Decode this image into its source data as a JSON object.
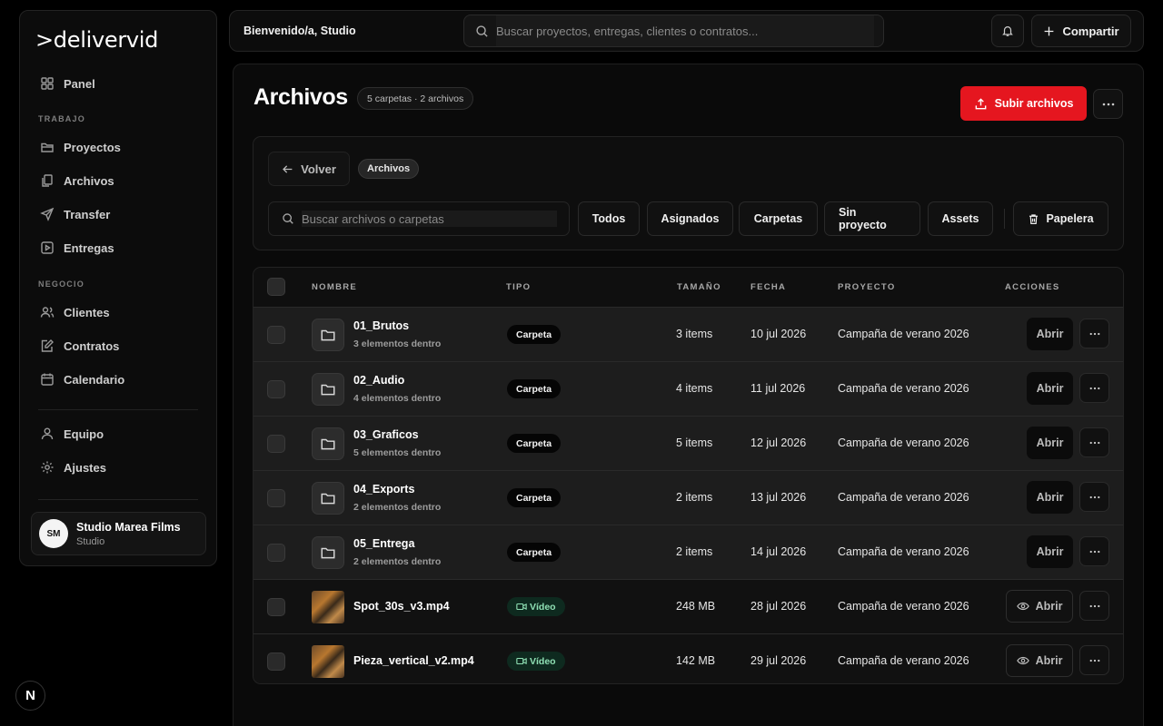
{
  "app": {
    "logo": ">delivervid",
    "next_badge": "N"
  },
  "sidebar": {
    "panel": "Panel",
    "section_work": "TRABAJO",
    "projects": "Proyectos",
    "files": "Archivos",
    "transfer": "Transfer",
    "deliveries": "Entregas",
    "section_business": "NEGOCIO",
    "clients": "Clientes",
    "contracts": "Contratos",
    "calendar": "Calendario",
    "team": "Equipo",
    "settings": "Ajustes",
    "user": {
      "initials": "SM",
      "name": "Studio Marea Films",
      "role": "Studio"
    }
  },
  "topbar": {
    "welcome": "Bienvenido/a, Studio",
    "search_placeholder": "Buscar proyectos, entregas, clientes o contratos...",
    "share_label": "Compartir"
  },
  "page": {
    "title": "Archivos",
    "count": "5 carpetas · 2 archivos",
    "upload_label": "Subir archivos"
  },
  "toolbar": {
    "back_label": "Volver",
    "breadcrumb": "Archivos",
    "search_placeholder": "Buscar archivos o carpetas",
    "filters": {
      "all": "Todos",
      "assigned": "Asignados",
      "folders": "Carpetas",
      "no_project": "Sin proyecto",
      "assets": "Assets"
    },
    "trash_label": "Papelera"
  },
  "table": {
    "headers": {
      "name": "NOMBRE",
      "type": "TIPO",
      "size": "TAMAÑO",
      "date": "FECHA",
      "project": "PROYECTO",
      "actions": "ACCIONES"
    },
    "rows": [
      {
        "name": "01_Brutos",
        "sub": "3 elementos dentro",
        "type": "Carpeta",
        "size": "3 items",
        "date": "10 jul 2026",
        "project": "Campaña de verano 2026",
        "action": "Abrir"
      },
      {
        "name": "02_Audio",
        "sub": "4 elementos dentro",
        "type": "Carpeta",
        "size": "4 items",
        "date": "11 jul 2026",
        "project": "Campaña de verano 2026",
        "action": "Abrir"
      },
      {
        "name": "03_Graficos",
        "sub": "5 elementos dentro",
        "type": "Carpeta",
        "size": "5 items",
        "date": "12 jul 2026",
        "project": "Campaña de verano 2026",
        "action": "Abrir"
      },
      {
        "name": "04_Exports",
        "sub": "2 elementos dentro",
        "type": "Carpeta",
        "size": "2 items",
        "date": "13 jul 2026",
        "project": "Campaña de verano 2026",
        "action": "Abrir"
      },
      {
        "name": "05_Entrega",
        "sub": "2 elementos dentro",
        "type": "Carpeta",
        "size": "2 items",
        "date": "14 jul 2026",
        "project": "Campaña de verano 2026",
        "action": "Abrir"
      },
      {
        "name": "Spot_30s_v3.mp4",
        "type": "Vídeo",
        "size": "248 MB",
        "date": "28 jul 2026",
        "project": "Campaña de verano 2026",
        "action": "Abrir"
      },
      {
        "name": "Pieza_vertical_v2.mp4",
        "type": "Vídeo",
        "size": "142 MB",
        "date": "29 jul 2026",
        "project": "Campaña de verano 2026",
        "action": "Abrir"
      }
    ]
  },
  "colors": {
    "accent": "#e5161f",
    "video_badge_bg": "#0e2a1f",
    "video_badge_text": "#8fe0b4"
  }
}
